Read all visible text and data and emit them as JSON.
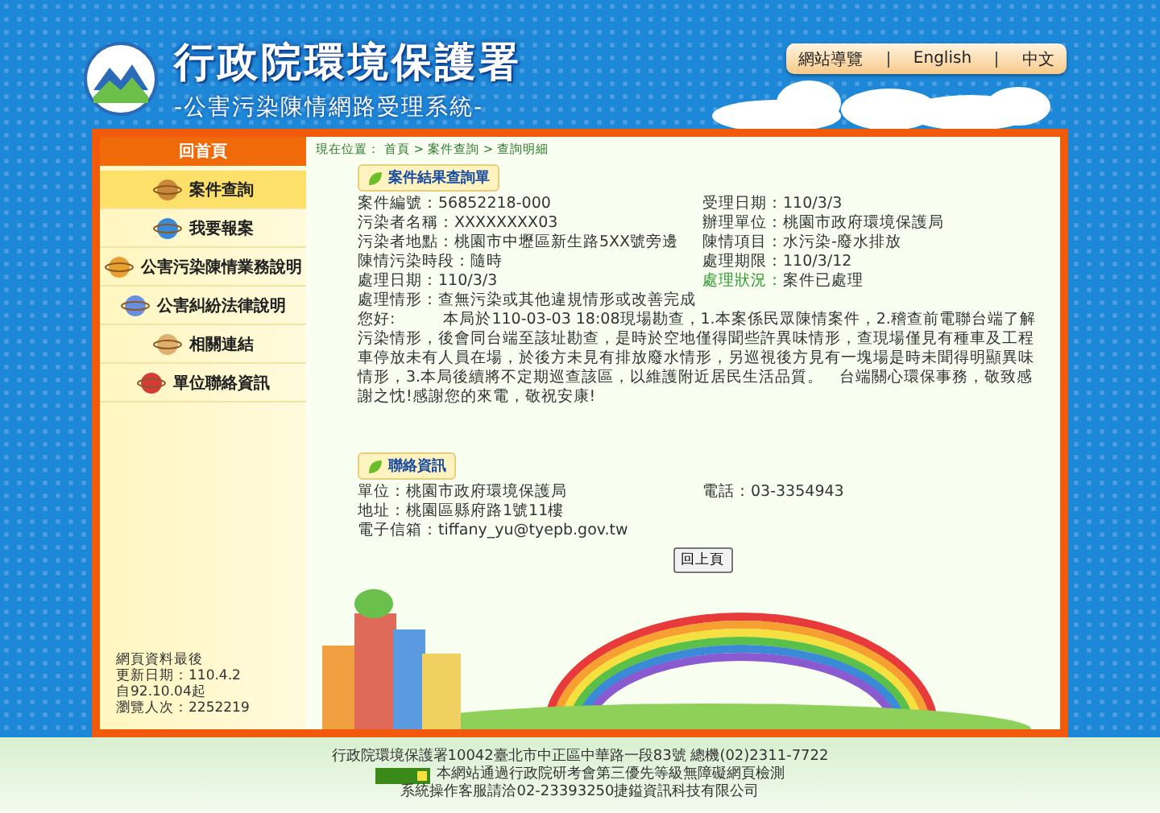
{
  "header": {
    "title": "行政院環境保護署",
    "subtitle": "-公害污染陳情網路受理系統-",
    "nav": [
      "網站導覽",
      "English",
      "中文"
    ]
  },
  "sidebar": {
    "home": "回首頁",
    "items": [
      {
        "label": "案件查詢",
        "selected": true
      },
      {
        "label": "我要報案",
        "selected": false
      },
      {
        "label": "公害污染陳情業務說明",
        "selected": false
      },
      {
        "label": "公害糾紛法律說明",
        "selected": false
      },
      {
        "label": "相關連結",
        "selected": false
      },
      {
        "label": "單位聯絡資訊",
        "selected": false
      }
    ],
    "stats": [
      "網頁資料最後",
      "更新日期：110.4.2",
      "自92.10.04起",
      "瀏覽人次：2252219"
    ]
  },
  "breadcrumb": "現在位置： 首頁 > 案件查詢 > 查詢明細",
  "case": {
    "title": "案件結果查詢單",
    "rows": [
      [
        {
          "label": "案件編號：",
          "value": "56852218-000",
          "highlight": false
        },
        {
          "label": "受理日期：",
          "value": "110/3/3",
          "highlight": false
        }
      ],
      [
        {
          "label": "污染者名稱：",
          "value": "XXXXXXXX03",
          "highlight": false
        },
        {
          "label": "辦理單位：",
          "value": "桃園市政府環境保護局",
          "highlight": false
        }
      ],
      [
        {
          "label": "污染者地點：",
          "value": "桃園市中壢區新生路5XX號旁邊",
          "highlight": false
        },
        {
          "label": "陳情項目：",
          "value": "水污染-廢水排放",
          "highlight": false
        }
      ],
      [
        {
          "label": "陳情污染時段：",
          "value": "隨時",
          "highlight": false
        },
        {
          "label": "處理期限：",
          "value": "110/3/12",
          "highlight": false
        }
      ],
      [
        {
          "label": "處理日期：",
          "value": "110/3/3",
          "highlight": false
        },
        {
          "label": "處理狀況：",
          "value": "案件已處理",
          "highlight": true
        }
      ]
    ],
    "result": "處理情形：查無污染或其他違規情形或改善完成",
    "greeting": "您好:",
    "reply": "本局於110-03-03 18:08現場勘查，1.本案係民眾陳情案件，2.稽查前電聯台端了解污染情形，後會同台端至該址勘查，是時於空地僅得聞些許異味情形，查現場僅見有種車及工程車停放未有人員在場，於後方未見有排放廢水情形，另巡視後方見有一塊場是時未聞得明顯異味情形，3.本局後續將不定期巡查該區，以維護附近居民生活品質。　台端關心環保事務，敬致感謝之忱!感謝您的來電，敬祝安康!"
  },
  "contact": {
    "title": "聯絡資訊",
    "rows": [
      [
        {
          "label": "單位：",
          "value": "桃園市政府環境保護局"
        },
        {
          "label": "電話：",
          "value": "03-3354943"
        }
      ],
      [
        {
          "label": "地址：",
          "value": "桃園區縣府路1號11樓"
        }
      ],
      [
        {
          "label": "電子信箱：",
          "value": "tiffany_yu@tyepb.gov.tw"
        }
      ]
    ]
  },
  "back_button": "回上頁",
  "footer": [
    "行政院環境保護署10042臺北市中正區中華路一段83號 總機(02)2311-7722",
    "本網站通過行政院研考會第三優先等級無障礙網頁檢測",
    "系統操作客服請洽02-23393250捷鎰資訊科技有限公司"
  ]
}
